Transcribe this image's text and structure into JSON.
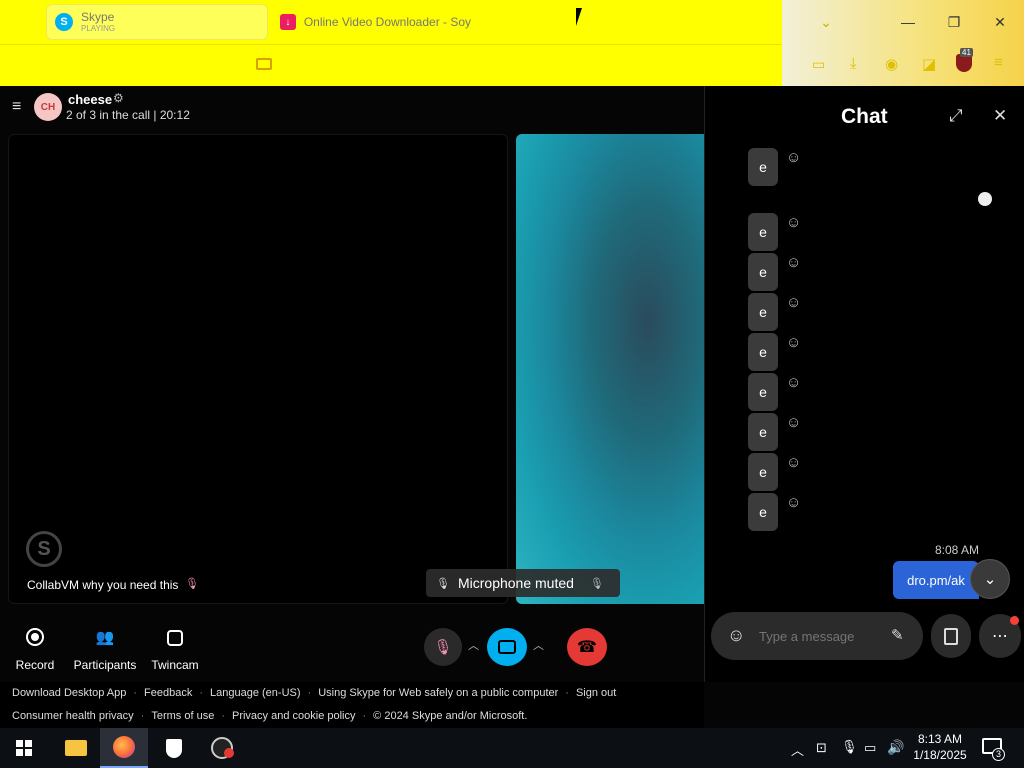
{
  "browser": {
    "tabs": [
      {
        "title": "Skype",
        "subtitle": "PLAYING"
      },
      {
        "title": "Online Video Downloader - Soy"
      }
    ]
  },
  "call": {
    "avatar_initials": "CH",
    "name": "cheese",
    "status": "2 of 3 in the call | 20:12",
    "left_tile_caption": "CollabVM why you need this",
    "toast": "Microphone muted",
    "controls": {
      "record": "Record",
      "participants": "Participants",
      "twincam": "Twincam"
    }
  },
  "chat": {
    "title": "Chat",
    "messages": [
      "e",
      "e",
      "e",
      "e",
      "e",
      "e",
      "e",
      "e",
      "e"
    ],
    "timestamp": "8:08 AM",
    "sent_message": "dro.pm/ak",
    "input_placeholder": "Type a message"
  },
  "footer": {
    "row1": [
      "Download Desktop App",
      "Feedback",
      "Language (en-US)",
      "Using Skype for Web safely on a public computer",
      "Sign out"
    ],
    "row2": [
      "Consumer health privacy",
      "Terms of use",
      "Privacy and cookie policy",
      "© 2024 Skype and/or Microsoft."
    ]
  },
  "taskbar": {
    "time": "8:13 AM",
    "date": "1/18/2025",
    "notifications": "3",
    "extension_badge": "41"
  },
  "colors": {
    "browser_bg": "#ffff00",
    "skype_blue": "#00aff0",
    "hangup_red": "#e53935",
    "sent_bubble": "#2a64d6"
  }
}
